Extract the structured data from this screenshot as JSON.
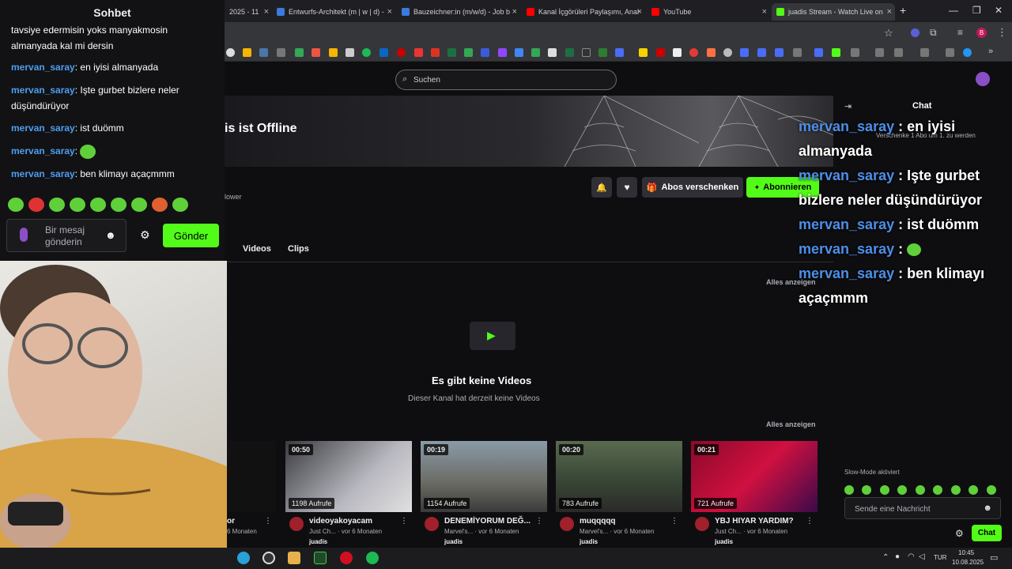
{
  "browser": {
    "tabs": [
      {
        "label": "2025 - 11",
        "color": "#888888"
      },
      {
        "label": "Entwurfs-Architekt (m | w | d) -",
        "color": "#3b7be0"
      },
      {
        "label": "Bauzeichner:in (m/w/d) - Job b",
        "color": "#3b7be0"
      },
      {
        "label": "Kanal İçgörüleri Paylaşımı, Anal",
        "color": "#ff0000"
      },
      {
        "label": "YouTube",
        "color": "#ff0000"
      },
      {
        "label": "juadis Stream - Watch Live on",
        "color": "#53fc18"
      }
    ],
    "new_tab": "+",
    "profile_initial": "B"
  },
  "kick": {
    "search_placeholder": "Suchen",
    "offline_text": "is ist Offline",
    "follower_label": "lower",
    "abos_label": "Abos verschenken",
    "subscribe_label": "Abonnieren",
    "tabs": [
      "Videos",
      "Clips"
    ],
    "tab_dot": "·",
    "see_all_1": "Alles anzeigen",
    "see_all_2": "Alles anzeigen",
    "no_videos_title": "Es gibt keine Videos",
    "no_videos_sub": "Dieser Kanal hat derzeit keine Videos",
    "chat_header": "Chat",
    "gift_notice": "Verschenke 1 Abo um 1. zu werden",
    "slow_mode": "Slow-Mode aktiviert",
    "chat_placeholder": "Sende eine Nachricht",
    "chat_button": "Chat",
    "clips": [
      {
        "duration": "",
        "views": "",
        "title": "or",
        "meta": "6 Monaten",
        "user": ""
      },
      {
        "duration": "00:50",
        "views": "1198 Aufrufe",
        "title": "videoyakoyacam",
        "meta": "Just Ch... · vor 6 Monaten",
        "user": "juadis"
      },
      {
        "duration": "00:19",
        "views": "1154 Aufrufe",
        "title": "DENEMİYORUM DEĞ...",
        "meta": "Marvel's... · vor 6 Monaten",
        "user": "juadis"
      },
      {
        "duration": "00:20",
        "views": "783 Aufrufe",
        "title": "muqqqqq",
        "meta": "Marvel's... · vor 6 Monaten",
        "user": "juadis"
      },
      {
        "duration": "00:21",
        "views": "721 Aufrufe",
        "title": "YBJ HIYAR YARDIM?",
        "meta": "Just Ch... · vor 6 Monaten",
        "user": "juadis"
      }
    ]
  },
  "overlay_chat": [
    {
      "user": "mervan_saray",
      "text": " : en iyisi almanyada"
    },
    {
      "user": "mervan_saray",
      "text": " : Işte gurbet bizlere neler düşündürüyor"
    },
    {
      "user": "mervan_saray",
      "text": " : ist duömm"
    },
    {
      "user": "mervan_saray",
      "text": " : "
    },
    {
      "user": "mervan_saray",
      "text": " : ben klimayı açaçmmm"
    }
  ],
  "left_chat": {
    "title": "Sohbet",
    "top_text": "tavsiye edermisin yoks manyakmosin almanyada kal mi dersin",
    "messages": [
      {
        "user": "mervan_saray",
        "text": ": en iyisi almanyada"
      },
      {
        "user": "mervan_saray",
        "text": ": Işte gurbet bizlere neler düşündürüyor"
      },
      {
        "user": "mervan_saray",
        "text": ": ist duömm"
      },
      {
        "user": "mervan_saray",
        "text": ": "
      },
      {
        "user": "mervan_saray",
        "text": ": ben klimayı açaçmmm"
      }
    ],
    "input_placeholder": "Bir mesaj gönderin",
    "send_label": "Gönder"
  },
  "taskbar": {
    "lang": "TUR",
    "time": "10:45",
    "date": "10.08.2025"
  }
}
